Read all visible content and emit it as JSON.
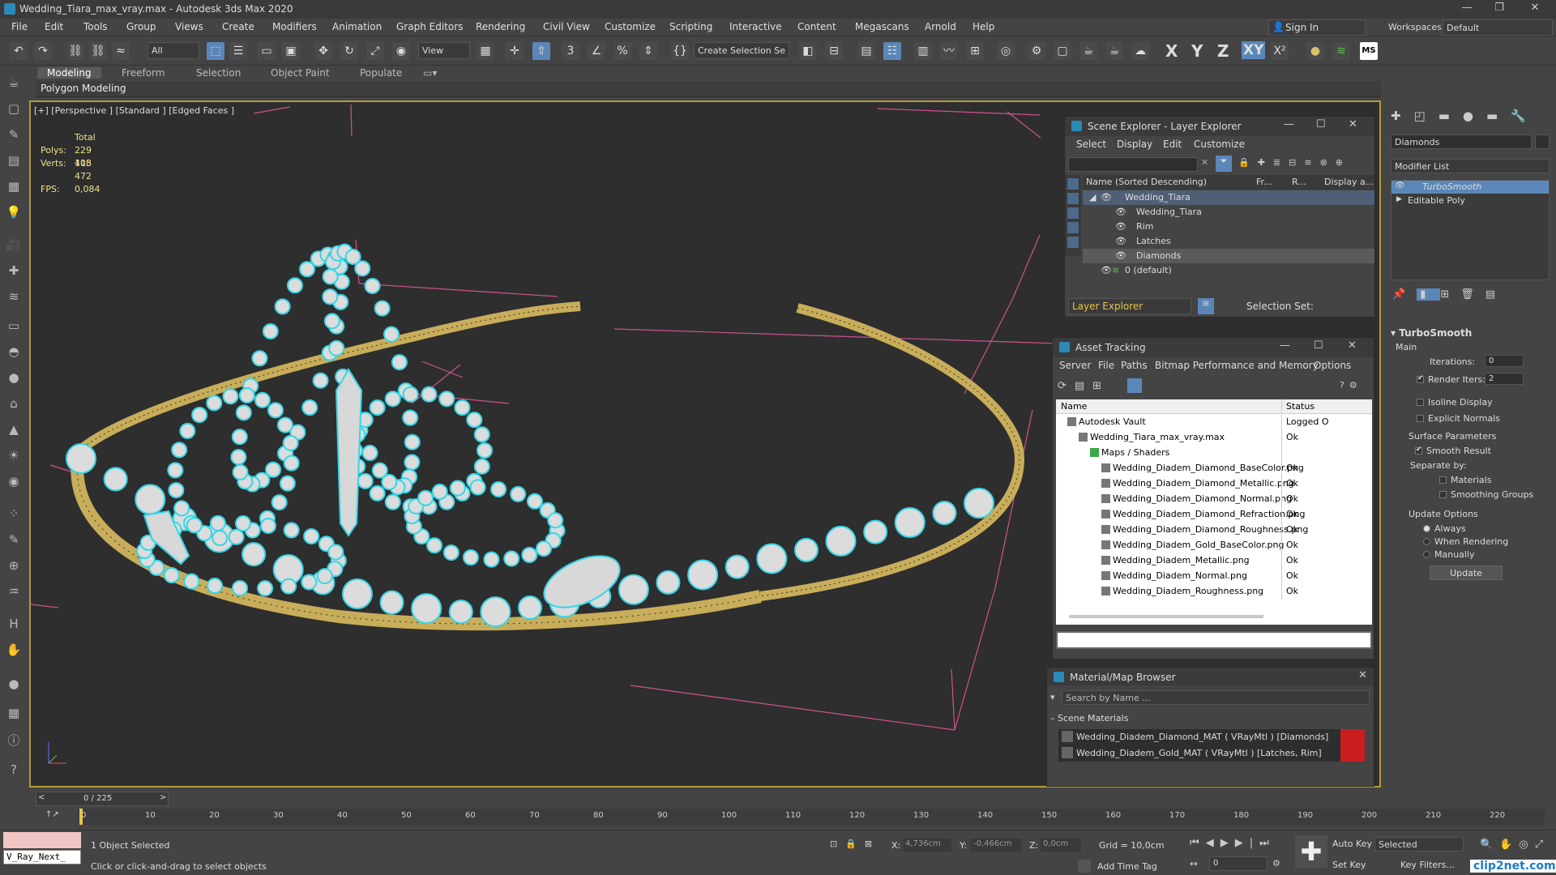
{
  "window": {
    "title": "Wedding_Tiara_max_vray.max - Autodesk 3ds Max 2020",
    "min": "—",
    "max": "❐",
    "close": "✕"
  },
  "menu": [
    "File",
    "Edit",
    "Tools",
    "Group",
    "Views",
    "Create",
    "Modifiers",
    "Animation",
    "Graph Editors",
    "Rendering",
    "Civil View",
    "Customize",
    "Scripting",
    "Interactive",
    "Content",
    "Megascans",
    "Arnold",
    "Help"
  ],
  "account": {
    "signin": "Sign In",
    "workspaces_label": "Workspaces:",
    "workspace": "Default"
  },
  "toolbar": {
    "filter": "All",
    "view": "View",
    "selection_set": "Create Selection Se",
    "axes": [
      "X",
      "Y",
      "Z",
      "XY"
    ],
    "ms": "MS"
  },
  "ribbon": {
    "tabs": [
      "Modeling",
      "Freeform",
      "Selection",
      "Object Paint",
      "Populate"
    ],
    "sub": "Polygon Modeling"
  },
  "viewport": {
    "label": "[+] [Perspective ] [Standard ] [Edged Faces ]",
    "stats": {
      "total": "Total",
      "polys_label": "Polys:",
      "polys": "229 408",
      "verts_label": "Verts:",
      "verts": "115 472",
      "fps_label": "FPS:",
      "fps": "0,084"
    }
  },
  "scene_explorer": {
    "title": "Scene Explorer - Layer Explorer",
    "menu": [
      "Select",
      "Display",
      "Edit",
      "Customize"
    ],
    "columns": [
      "Name (Sorted Descending)",
      "Fr...",
      "R...",
      "Display a..."
    ],
    "rows": [
      {
        "name": "Wedding_Tiara",
        "level": 0
      },
      {
        "name": "Wedding_Tiara",
        "level": 1
      },
      {
        "name": "Rim",
        "level": 1
      },
      {
        "name": "Latches",
        "level": 1
      },
      {
        "name": "Diamonds",
        "level": 1
      },
      {
        "name": "0 (default)",
        "level": -1
      }
    ],
    "footer_explorer": "Layer Explorer",
    "footer_selset": "Selection Set:"
  },
  "asset_tracking": {
    "title": "Asset Tracking",
    "menu": [
      "Server",
      "File",
      "Paths",
      "Bitmap Performance and Memory",
      "Options"
    ],
    "columns": [
      "Name",
      "Status"
    ],
    "rows": [
      {
        "name": "Autodesk Vault",
        "status": "Logged O",
        "level": 0
      },
      {
        "name": "Wedding_Tiara_max_vray.max",
        "status": "Ok",
        "level": 1
      },
      {
        "name": "Maps / Shaders",
        "status": "",
        "level": 2
      },
      {
        "name": "Wedding_Diadem_Diamond_BaseColor.png",
        "status": "Ok",
        "level": 3
      },
      {
        "name": "Wedding_Diadem_Diamond_Metallic.png",
        "status": "Ok",
        "level": 3
      },
      {
        "name": "Wedding_Diadem_Diamond_Normal.png",
        "status": "Ok",
        "level": 3
      },
      {
        "name": "Wedding_Diadem_Diamond_Refraction.png",
        "status": "Ok",
        "level": 3
      },
      {
        "name": "Wedding_Diadem_Diamond_Roughness.png",
        "status": "Ok",
        "level": 3
      },
      {
        "name": "Wedding_Diadem_Gold_BaseColor.png",
        "status": "Ok",
        "level": 3
      },
      {
        "name": "Wedding_Diadem_Metallic.png",
        "status": "Ok",
        "level": 3
      },
      {
        "name": "Wedding_Diadem_Normal.png",
        "status": "Ok",
        "level": 3
      },
      {
        "name": "Wedding_Diadem_Roughness.png",
        "status": "Ok",
        "level": 3
      }
    ]
  },
  "material_browser": {
    "title": "Material/Map Browser",
    "search_placeholder": "Search by Name ...",
    "group": "Scene Materials",
    "items": [
      "Wedding_Diadem_Diamond_MAT  ( VRayMtl )  [Diamonds]",
      "Wedding_Diadem_Gold_MAT  ( VRayMtl )  [Latches, Rim]"
    ]
  },
  "command_panel": {
    "object_name": "Diamonds",
    "modifier_list": "Modifier List",
    "stack": [
      "TurboSmooth",
      "Editable Poly"
    ],
    "rollout": "TurboSmooth",
    "main": "Main",
    "iterations_label": "Iterations:",
    "iterations": "0",
    "render_iters_label": "Render Iters:",
    "render_iters": "2",
    "isoline": "Isoline Display",
    "explicit_normals": "Explicit Normals",
    "surface_params": "Surface Parameters",
    "smooth_result": "Smooth Result",
    "separate_by": "Separate by:",
    "materials": "Materials",
    "smoothing_groups": "Smoothing Groups",
    "update_options": "Update Options",
    "always": "Always",
    "when_rendering": "When Rendering",
    "manually": "Manually",
    "update": "Update"
  },
  "timeline": {
    "frame": "0 / 225",
    "ticks": [
      "0",
      "10",
      "20",
      "30",
      "40",
      "50",
      "60",
      "70",
      "80",
      "90",
      "100",
      "110",
      "120",
      "130",
      "140",
      "150",
      "160",
      "170",
      "180",
      "190",
      "200",
      "210",
      "220"
    ]
  },
  "status": {
    "script_box": "V_Ray_Next_",
    "selected": "1 Object Selected",
    "prompt": "Click or click-and-drag to select objects",
    "x_label": "X:",
    "x": "4,736cm",
    "y_label": "Y:",
    "y": "-0,466cm",
    "z_label": "Z:",
    "z": "0,0cm",
    "grid": "Grid = 10,0cm",
    "add_time_tag": "Add Time Tag",
    "auto_key": "Auto Key",
    "set_key": "Set Key",
    "selected_dd": "Selected",
    "key_filters": "Key Filters...",
    "frame_field": "0",
    "watermark": "clip2net.com"
  },
  "colors": {
    "accent": "#5b87b8",
    "viewport_border": "#b59a3a",
    "gold": "#c8ad5a",
    "selection": "#35d6e6"
  }
}
